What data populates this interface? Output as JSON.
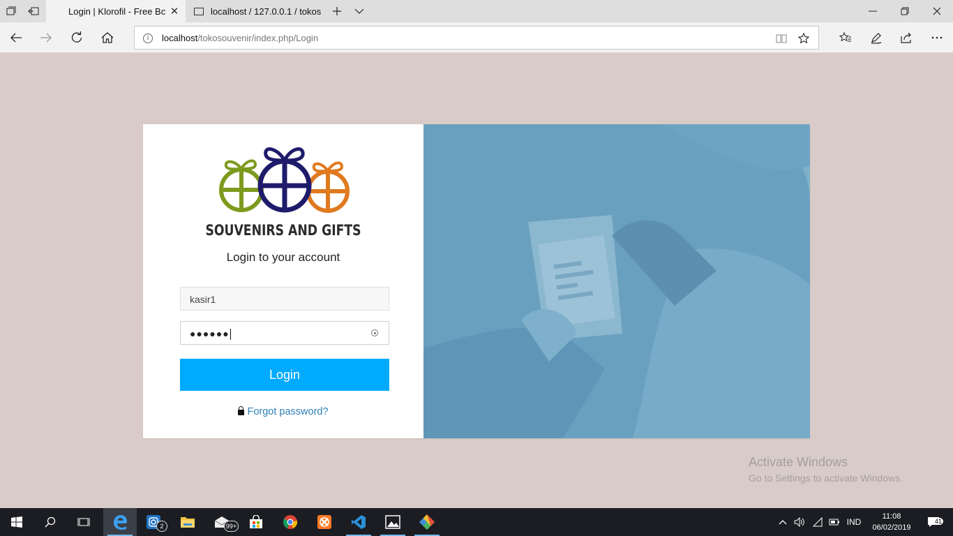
{
  "browser": {
    "tabs": [
      {
        "title": "Login | Klorofil - Free Bc",
        "active": true
      },
      {
        "title": "localhost / 127.0.0.1 / tokos",
        "active": false
      }
    ],
    "url_host": "localhost",
    "url_path": "/tokosouvenir/index.php/Login",
    "icons": [
      "tab-manager-icon",
      "set-aside-icon",
      "close-icon",
      "new-tab-icon",
      "chevron-down-icon",
      "back-icon",
      "forward-icon",
      "refresh-icon",
      "home-icon",
      "info-icon",
      "reading-view-icon",
      "favorite-star-icon",
      "favorites-hub-icon",
      "pen-icon",
      "share-icon",
      "more-icon",
      "minimize-icon",
      "restore-icon",
      "close-window-icon"
    ]
  },
  "login": {
    "brand": "SOUVENIRS AND GIFTS",
    "subtitle": "Login to your account",
    "username_value": "kasir1",
    "password_masked": "●●●●●●",
    "login_button": "Login",
    "forgot_link": "Forgot password?",
    "logo_colors": [
      "#7d9a1e",
      "#1f1b6b",
      "#e07a1f"
    ],
    "button_color": "#00aaff"
  },
  "watermark": {
    "line1": "Activate Windows",
    "line2": "Go to Settings to activate Windows."
  },
  "taskbar": {
    "apps": [
      {
        "name": "edge-icon",
        "active": true
      },
      {
        "name": "instagram-icon",
        "badge": "2"
      },
      {
        "name": "file-explorer-icon"
      },
      {
        "name": "mail-icon",
        "badge": "99+"
      },
      {
        "name": "store-icon"
      },
      {
        "name": "chrome-icon"
      },
      {
        "name": "xampp-icon"
      },
      {
        "name": "vscode-icon"
      },
      {
        "name": "photos-icon"
      },
      {
        "name": "git-icon"
      }
    ],
    "language": "IND",
    "time": "11:08",
    "date": "06/02/2019",
    "notifications": "41"
  }
}
